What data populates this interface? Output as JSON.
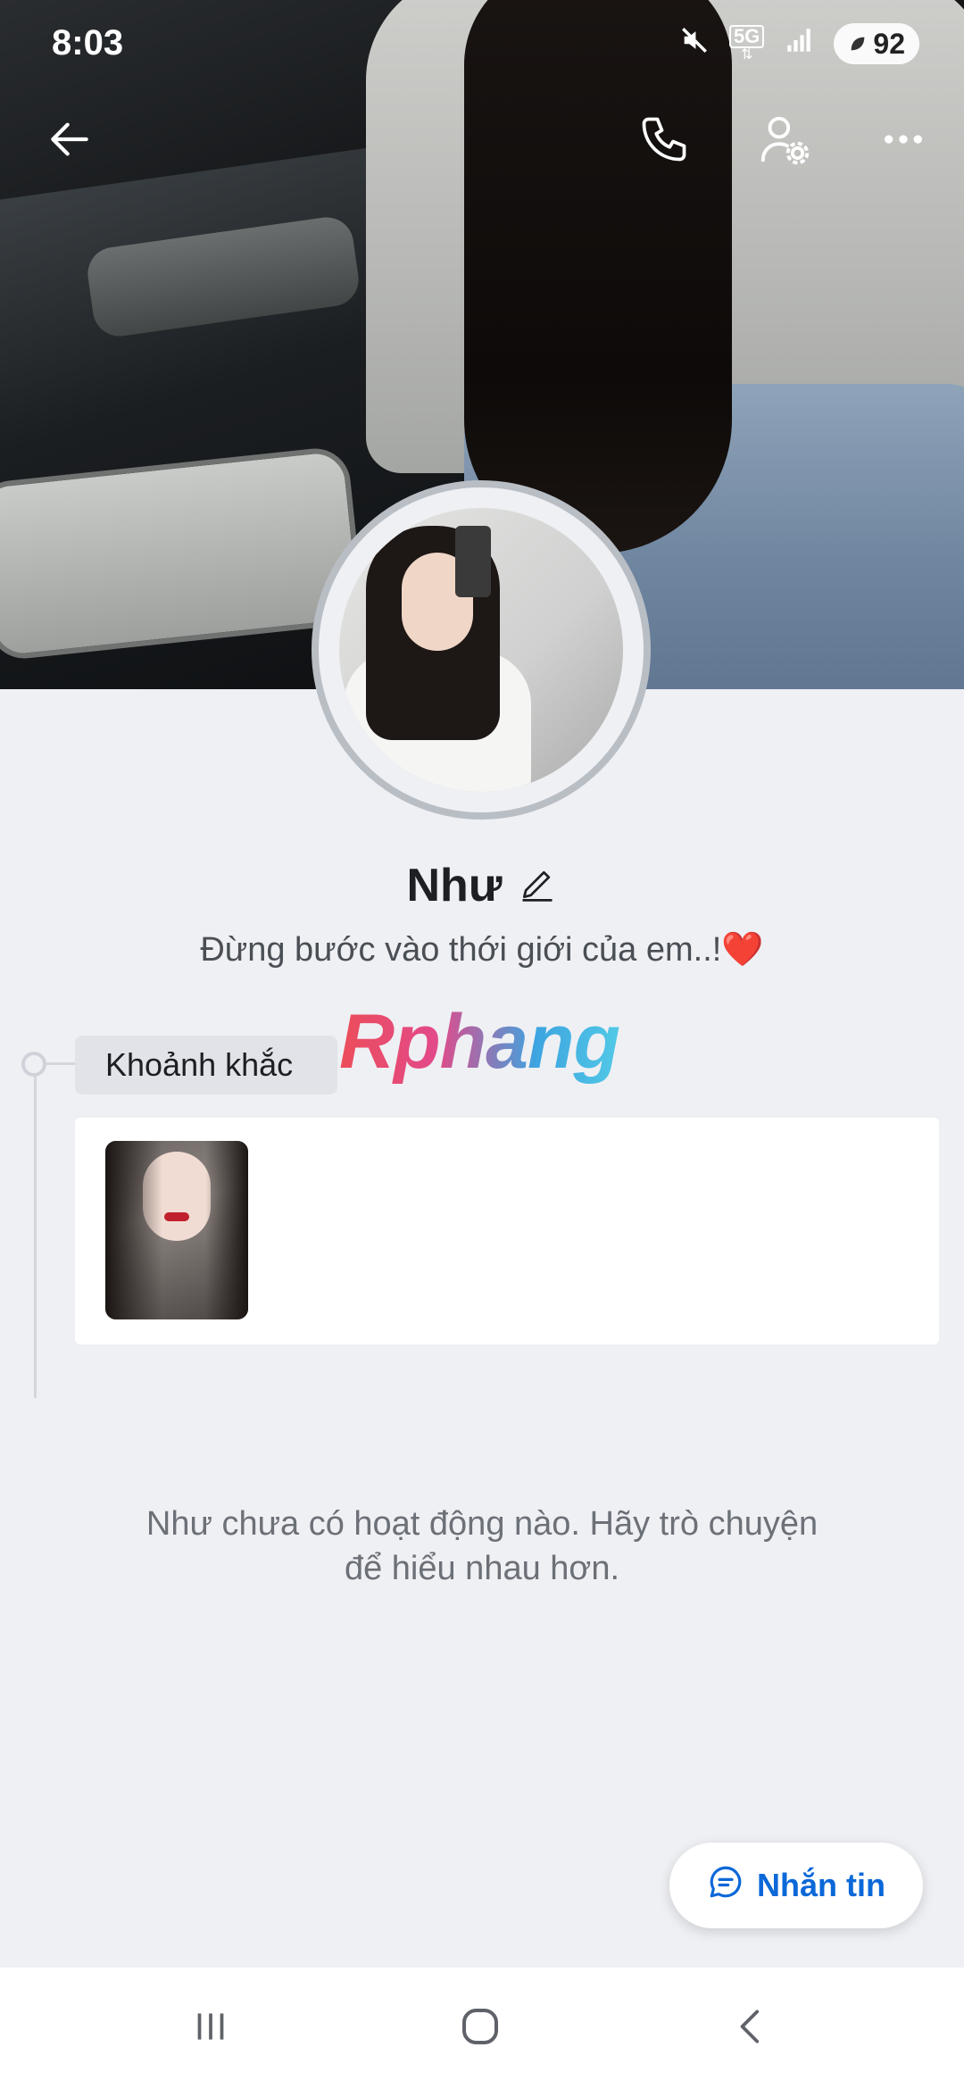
{
  "status_bar": {
    "time": "8:03",
    "network": "5G",
    "battery": "92",
    "icons": [
      "mute-icon",
      "5g-icon",
      "signal-icon",
      "battery-icon"
    ]
  },
  "top_bar": {
    "icons": [
      "back-arrow-icon",
      "phone-icon",
      "profile-settings-icon",
      "more-icon"
    ]
  },
  "profile": {
    "name": "Như",
    "bio": "Đừng bước vào thới giới của em..!",
    "bio_emoji": "❤️",
    "edit_icon": "pencil-icon"
  },
  "watermark": "Rphang",
  "timeline": {
    "section_label": "Khoảnh khắc"
  },
  "empty_state": {
    "line1": "Như chưa có hoạt động nào. Hãy trò chuyện",
    "line2": "để hiểu nhau hơn."
  },
  "message_button": {
    "label": "Nhắn tin",
    "icon": "chat-bubble-icon"
  },
  "nav_bar": {
    "icons": [
      "recents-icon",
      "home-icon",
      "back-icon"
    ]
  },
  "colors": {
    "accent": "#0b68d8",
    "background": "#eff0f4"
  }
}
